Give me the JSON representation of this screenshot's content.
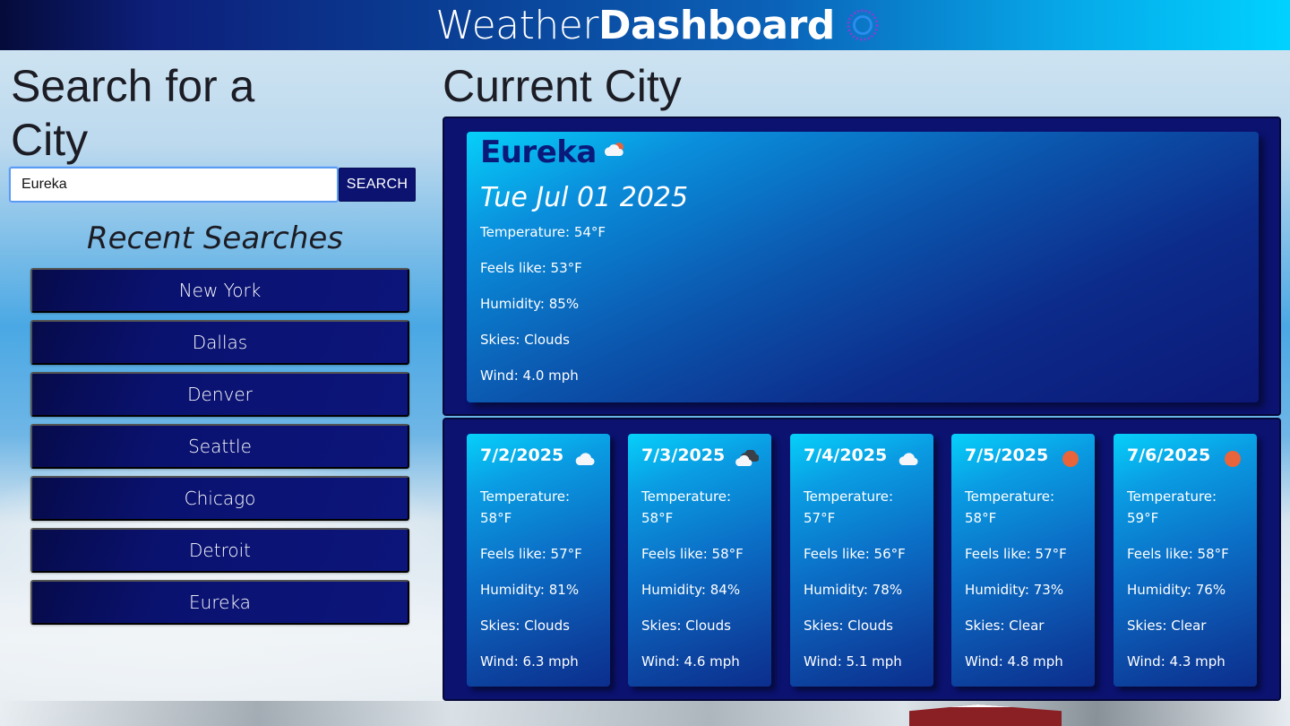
{
  "header": {
    "title_light": "Weather",
    "title_bold": "Dashboard",
    "logo_icon": "sun-icon",
    "gradient_start": "#050b3a",
    "gradient_end": "#00d2ff"
  },
  "search": {
    "heading": "Search for a City",
    "input_value": "Eureka",
    "button_label": "SEARCH"
  },
  "recent": {
    "heading": "Recent Searches",
    "items": [
      {
        "label": "New York"
      },
      {
        "label": "Dallas"
      },
      {
        "label": "Denver"
      },
      {
        "label": "Seattle"
      },
      {
        "label": "Chicago"
      },
      {
        "label": "Detroit"
      },
      {
        "label": "Eureka"
      }
    ]
  },
  "current": {
    "heading": "Current City",
    "city": "Eureka",
    "icon": "partly-cloudy-icon",
    "date": "Tue Jul 01 2025",
    "temperature": "Temperature: 54°F",
    "feels_like": "Feels like: 53°F",
    "humidity": "Humidity: 85%",
    "skies": "Skies: Clouds",
    "wind": "Wind: 4.0 mph"
  },
  "forecast": [
    {
      "date": "7/2/2025",
      "icon": "cloud-icon",
      "temperature": "Temperature: 58°F",
      "feels_like": "Feels like: 57°F",
      "humidity": "Humidity: 81%",
      "skies": "Skies: Clouds",
      "wind": "Wind: 6.3 mph"
    },
    {
      "date": "7/3/2025",
      "icon": "dark-cloud-icon",
      "temperature": "Temperature: 58°F",
      "feels_like": "Feels like: 58°F",
      "humidity": "Humidity: 84%",
      "skies": "Skies: Clouds",
      "wind": "Wind: 4.6 mph"
    },
    {
      "date": "7/4/2025",
      "icon": "cloud-icon",
      "temperature": "Temperature: 57°F",
      "feels_like": "Feels like: 56°F",
      "humidity": "Humidity: 78%",
      "skies": "Skies: Clouds",
      "wind": "Wind: 5.1 mph"
    },
    {
      "date": "7/5/2025",
      "icon": "sun-icon",
      "temperature": "Temperature: 58°F",
      "feels_like": "Feels like: 57°F",
      "humidity": "Humidity: 73%",
      "skies": "Skies: Clear",
      "wind": "Wind: 4.8 mph"
    },
    {
      "date": "7/6/2025",
      "icon": "sun-icon",
      "temperature": "Temperature: 59°F",
      "feels_like": "Feels like: 58°F",
      "humidity": "Humidity: 76%",
      "skies": "Skies: Clear",
      "wind": "Wind: 4.3 mph"
    }
  ],
  "colors": {
    "panel": "#0b1270",
    "recent_button": "#0a1270",
    "city_name": "#0a1a7a",
    "sun": "#e8643a"
  }
}
